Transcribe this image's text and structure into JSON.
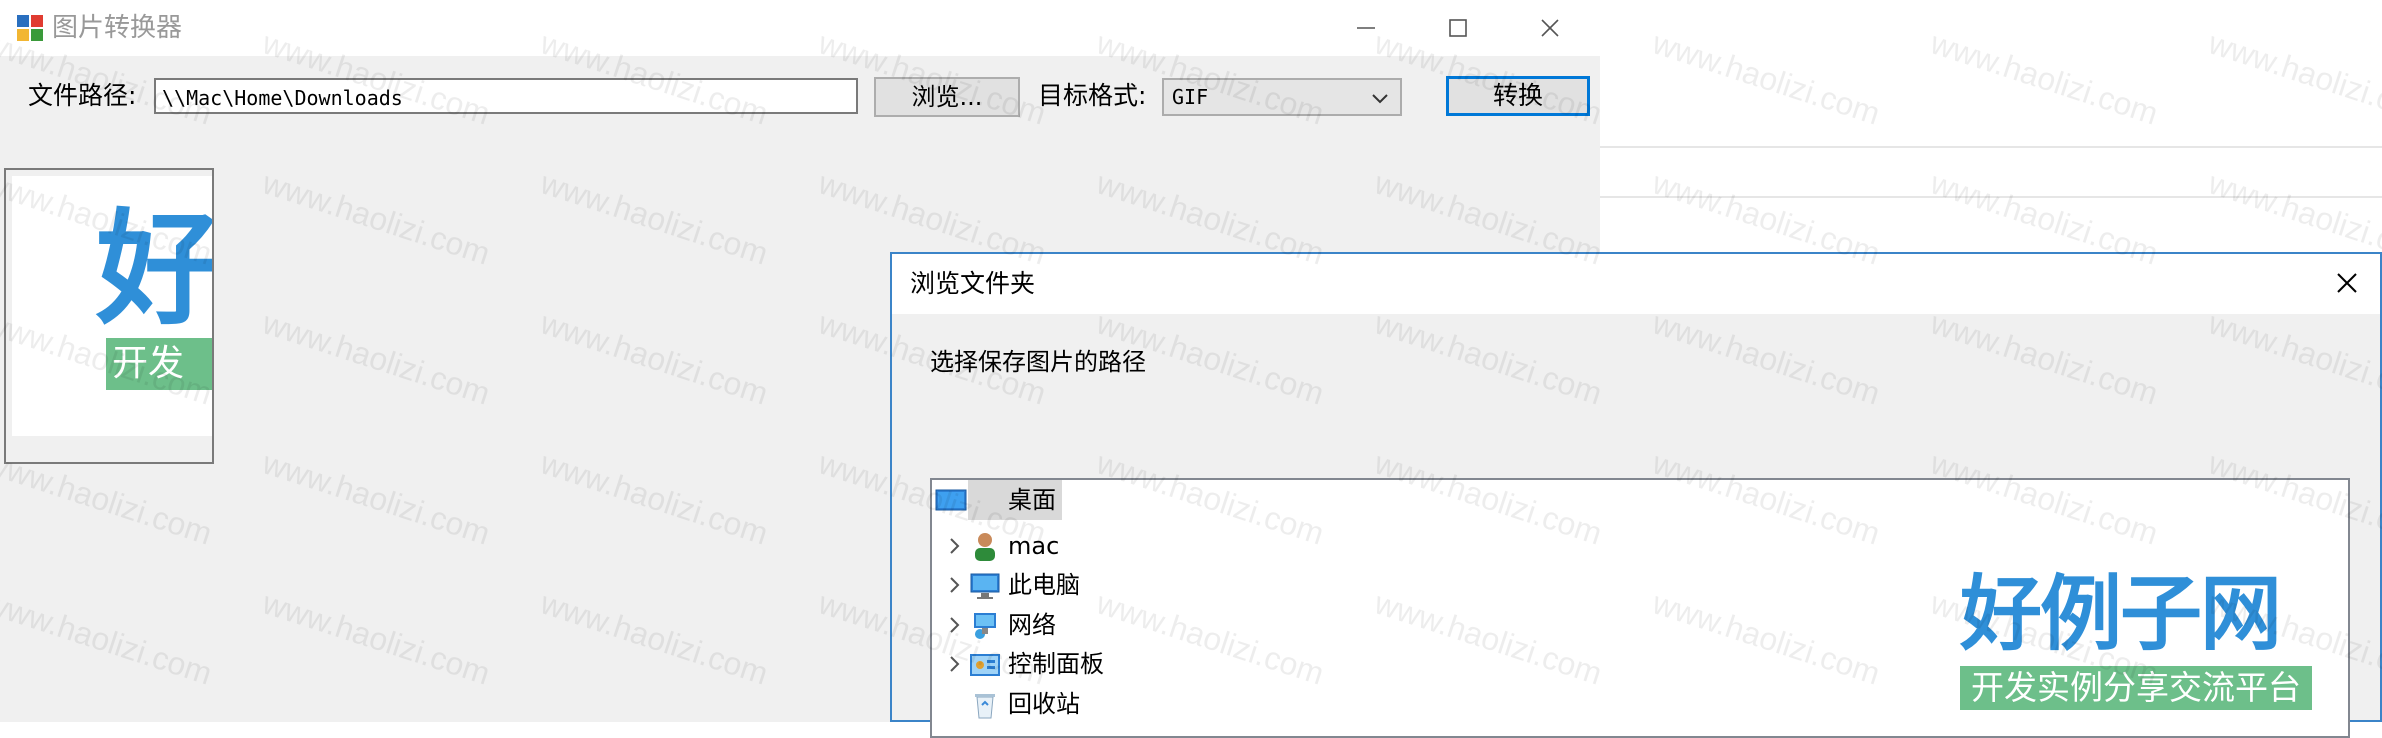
{
  "window": {
    "title": "图片转换器"
  },
  "toolbar": {
    "path_label": "文件路径:",
    "path_value": "\\\\Mac\\Home\\Downloads",
    "browse_label": "浏览...",
    "format_label": "目标格式:",
    "format_value": "GIF",
    "convert_label": "转换"
  },
  "preview": {
    "big_char": "好",
    "strip_text": "开发"
  },
  "dialog": {
    "title": "浏览文件夹",
    "instruction": "选择保存图片的路径",
    "tree": [
      {
        "label": "桌面",
        "icon": "desktop-icon",
        "selected": true,
        "expandable": false
      },
      {
        "label": "mac",
        "icon": "user-icon",
        "selected": false,
        "expandable": true
      },
      {
        "label": "此电脑",
        "icon": "computer-icon",
        "selected": false,
        "expandable": true
      },
      {
        "label": "网络",
        "icon": "network-icon",
        "selected": false,
        "expandable": true
      },
      {
        "label": "控制面板",
        "icon": "control-panel-icon",
        "selected": false,
        "expandable": true
      },
      {
        "label": "回收站",
        "icon": "recycle-bin-icon",
        "selected": false,
        "expandable": false
      }
    ]
  },
  "watermark": {
    "text": "www.haolizi.com",
    "brand_title": "好例子网",
    "brand_subtitle": "开发实例分享交流平台"
  },
  "colors": {
    "accent": "#0078d7",
    "brand_blue": "#2f8fd8",
    "brand_green": "#6dbf8a"
  }
}
